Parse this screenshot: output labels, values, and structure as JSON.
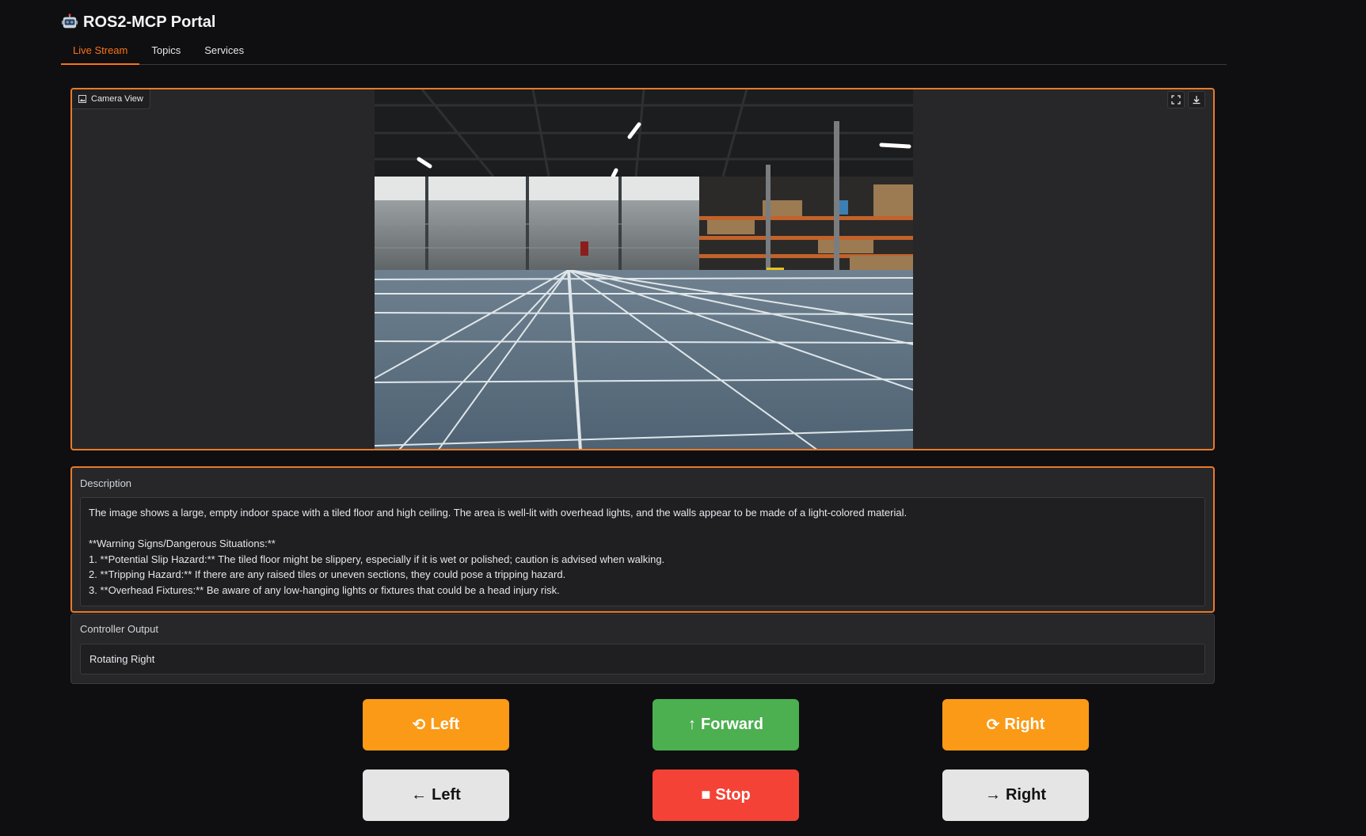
{
  "app": {
    "title": "ROS2-MCP Portal",
    "icon": "robot-icon"
  },
  "tabs": [
    {
      "label": "Live Stream",
      "active": true
    },
    {
      "label": "Topics",
      "active": false
    },
    {
      "label": "Services",
      "active": false
    }
  ],
  "camera": {
    "label": "Camera View",
    "tools": [
      "fullscreen-icon",
      "download-icon"
    ]
  },
  "description": {
    "label": "Description",
    "text": "The image shows a large, empty indoor space with a tiled floor and high ceiling. The area is well-lit with overhead lights, and the walls appear to be made of a light-colored material.\n\n**Warning Signs/Dangerous Situations:**\n1. **Potential Slip Hazard:** The tiled floor might be slippery, especially if it is wet or polished; caution is advised when walking.\n2. **Tripping Hazard:** If there are any raised tiles or uneven sections, they could pose a tripping hazard.\n3. **Overhead Fixtures:** Be aware of any low-hanging lights or fixtures that could be a head injury risk."
  },
  "controller": {
    "label": "Controller Output",
    "value": "Rotating Right"
  },
  "controls": {
    "rotate_left": {
      "glyph": "⟲",
      "label": "Left"
    },
    "forward": {
      "glyph": "↑",
      "label": "Forward"
    },
    "rotate_right": {
      "glyph": "⟳",
      "label": "Right"
    },
    "move_left": {
      "glyph": "←",
      "label": "Left"
    },
    "stop": {
      "glyph": "■",
      "label": "Stop"
    },
    "move_right": {
      "glyph": "→",
      "label": "Right"
    }
  },
  "colors": {
    "accent": "#ea7a28",
    "orange_button": "#fb9a16",
    "green_button": "#4caf50",
    "red_button": "#f44336",
    "light_button": "#e5e5e5",
    "background": "#0f0f11",
    "panel": "#27272a"
  }
}
